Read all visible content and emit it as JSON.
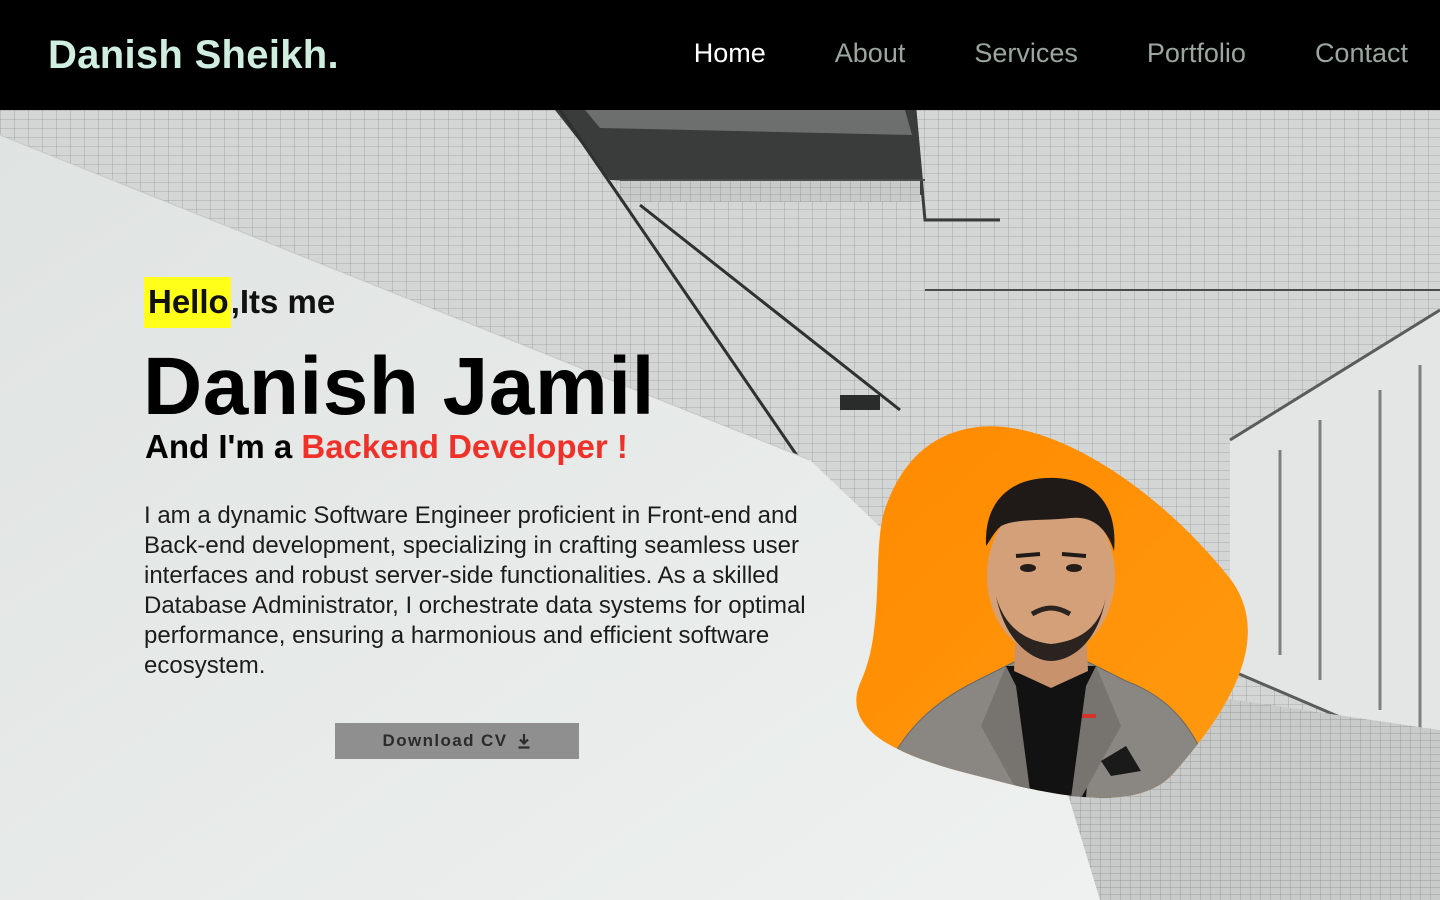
{
  "brand": "Danish Sheikh.",
  "nav": {
    "items": [
      {
        "label": "Home",
        "active": true
      },
      {
        "label": "About",
        "active": false
      },
      {
        "label": "Services",
        "active": false
      },
      {
        "label": "Portfolio",
        "active": false
      },
      {
        "label": "Contact",
        "active": false
      }
    ]
  },
  "hero": {
    "greeting_highlight": "Hello",
    "greeting_rest": ",Its me",
    "name": "Danish Jamil",
    "role_prefix": "And I'm a ",
    "role": "Backend Developer !",
    "bio": "I am a dynamic Software Engineer proficient in Front-end and Back-end development, specializing in crafting seamless user interfaces and robust server-side functionalities. As a skilled Database Administrator, I orchestrate data systems for optimal performance, ensuring a harmonious and efficient software ecosystem.",
    "cv_button": "Download CV",
    "cv_icon": "download-icon",
    "portrait_icon": "profile-photo"
  },
  "colors": {
    "navbar_bg": "#000000",
    "brand": "#cfeee0",
    "nav_active": "#ffffff",
    "nav_inactive": "#9aa79f",
    "highlight": "#ffff1a",
    "role_accent": "#f0312a",
    "blob": "#ff8c00",
    "button_bg": "#8e8f8e"
  }
}
